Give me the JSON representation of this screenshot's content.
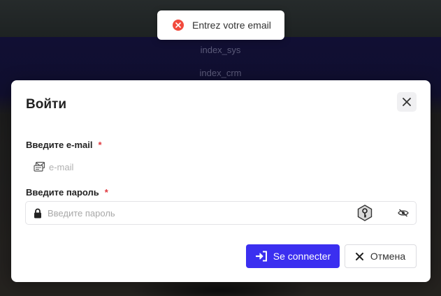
{
  "background": {
    "menu_items": [
      "index_sys",
      "index_crm"
    ]
  },
  "toast": {
    "icon": "error-circle-icon",
    "message": "Entrez votre email",
    "color": "#f24a3d"
  },
  "modal": {
    "title": "Войти",
    "close_icon": "close-icon",
    "email": {
      "label": "Введите e-mail",
      "required_mark": "*",
      "placeholder": "e-mail",
      "value": ""
    },
    "password": {
      "label": "Введите пароль",
      "required_mark": "*",
      "placeholder": "Введите пароль",
      "value": ""
    },
    "submit_label": "Se connecter",
    "cancel_label": "Отмена",
    "accent_color": "#3b2ff0"
  }
}
